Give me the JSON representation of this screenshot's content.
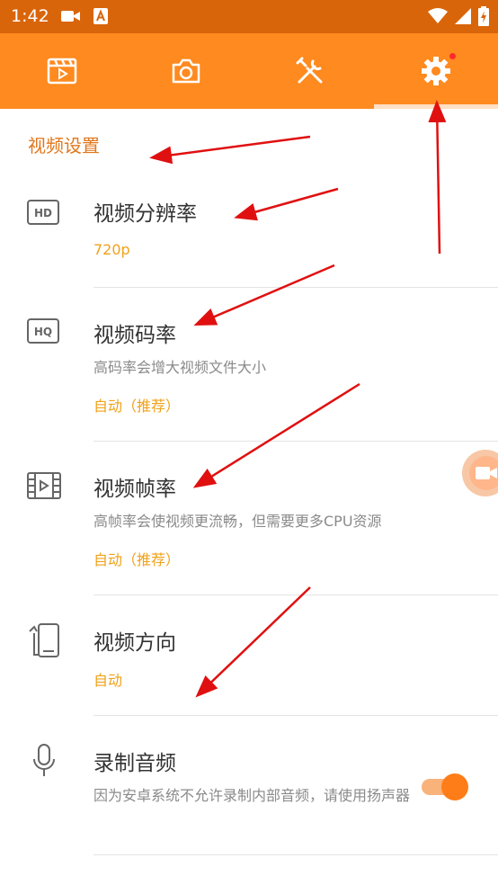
{
  "status_bar": {
    "time": "1:42"
  },
  "tabs": [
    {
      "name": "video-list"
    },
    {
      "name": "camera"
    },
    {
      "name": "tools"
    },
    {
      "name": "settings",
      "active": true
    }
  ],
  "section": {
    "title": "视频设置"
  },
  "settings": {
    "resolution": {
      "title": "视频分辨率",
      "value": "720p"
    },
    "bitrate": {
      "title": "视频码率",
      "desc": "高码率会增大视频文件大小",
      "value": "自动（推荐）"
    },
    "framerate": {
      "title": "视频帧率",
      "desc": "高帧率会使视频更流畅，但需要更多CPU资源",
      "value": "自动（推荐）"
    },
    "orientation": {
      "title": "视频方向",
      "value": "自动"
    },
    "audio": {
      "title": "录制音频",
      "desc": "因为安卓系统不允许录制内部音频，请使用扬声器",
      "enabled": true
    }
  },
  "colors": {
    "status_bar": "#d9650a",
    "tab_bar": "#ff8a1f",
    "accent": "#e2761b",
    "value": "#f0a21a",
    "annotation_arrow": "#e01010"
  }
}
